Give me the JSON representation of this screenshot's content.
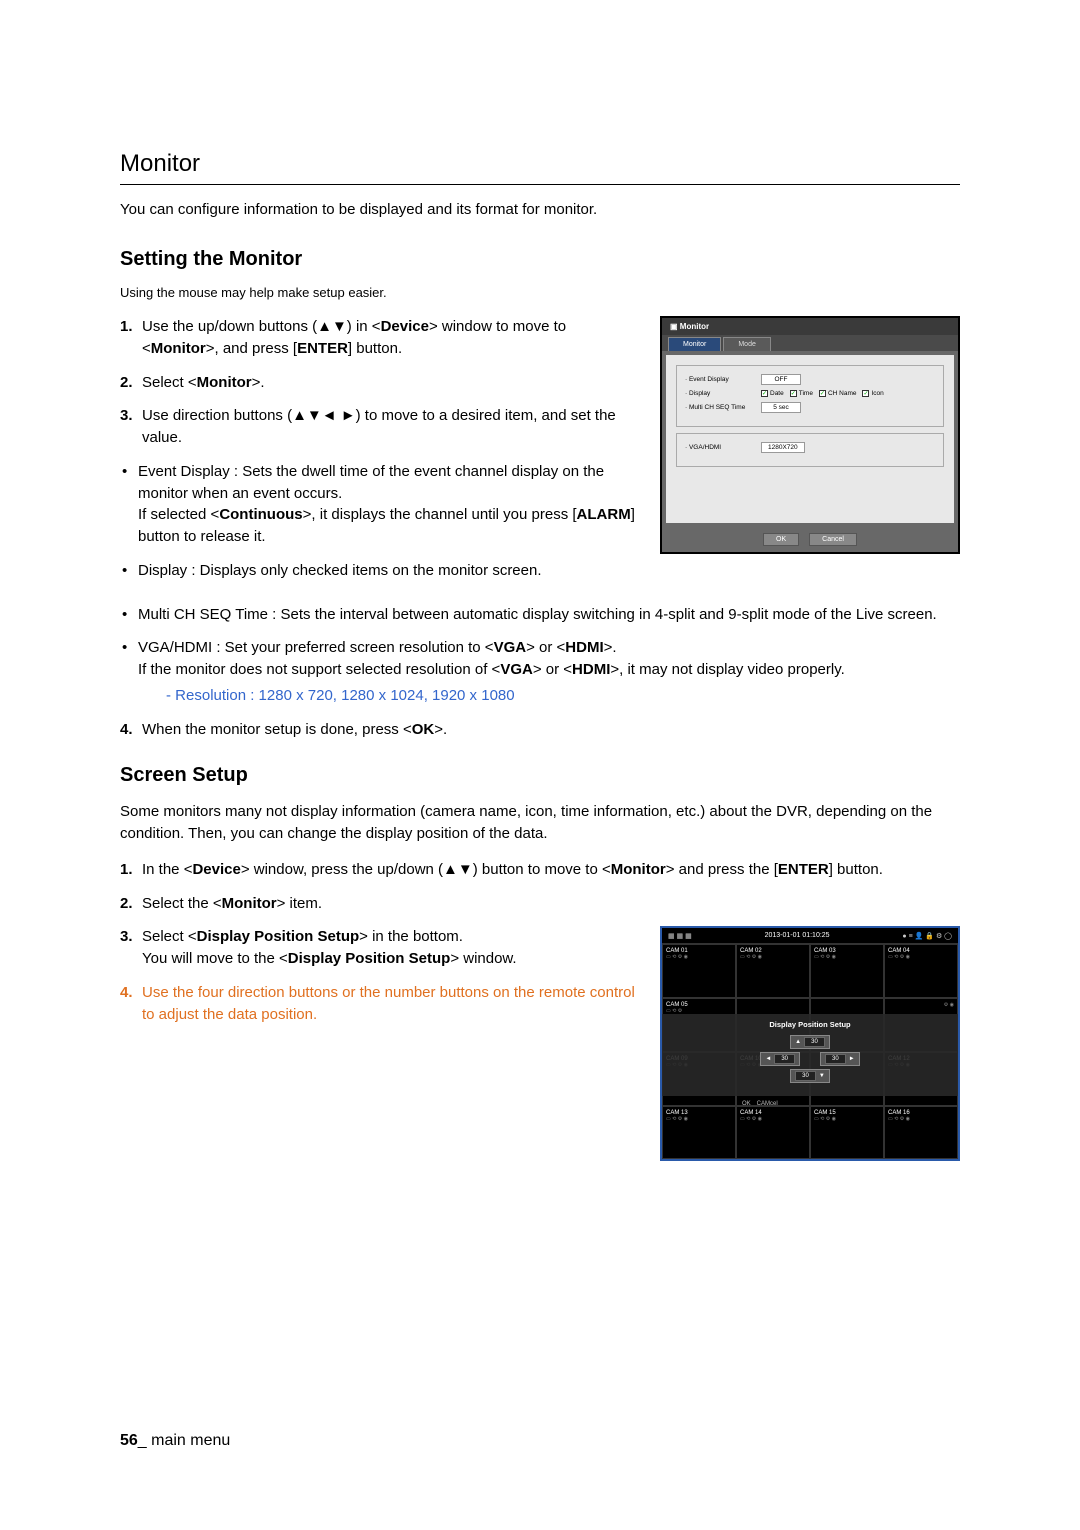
{
  "section_title": "Monitor",
  "intro": "You can configure information to be displayed and its format for monitor.",
  "setting_monitor": {
    "title": "Setting the Monitor",
    "note": "Using the mouse may help make setup easier.",
    "steps": {
      "s1_a": "Use the up/down buttons (▲▼) in <",
      "s1_b": "Device",
      "s1_c": "> window to move to <",
      "s1_d": "Monitor",
      "s1_e": ">, and press [",
      "s1_f": "ENTER",
      "s1_g": "] button.",
      "s2_a": "Select <",
      "s2_b": "Monitor",
      "s2_c": ">.",
      "s3": "Use direction buttons (▲▼◄ ►) to move to a desired item, and set the value.",
      "s4_a": "When the monitor setup is done, press <",
      "s4_b": "OK",
      "s4_c": ">."
    },
    "bullets": {
      "b1_a": "Event Display : Sets the dwell time of the event channel display on the monitor when an event occurs.",
      "b1_b": "If selected <",
      "b1_c": "Continuous",
      "b1_d": ">, it displays the channel until you press [",
      "b1_e": "ALARM",
      "b1_f": "] button to release it.",
      "b2": "Display : Displays only checked items on the monitor screen.",
      "b3": "Multi CH SEQ Time : Sets the interval between automatic display switching in 4-split and 9-split mode of the Live screen.",
      "b4_a": "VGA/HDMI : Set your preferred screen resolution to <",
      "b4_b": "VGA",
      "b4_c": "> or <",
      "b4_d": "HDMI",
      "b4_e": ">.",
      "b4_f": "If the monitor does not support selected resolution of <",
      "b4_g": ">, it may not display video properly."
    },
    "resolution_note": "Resolution : 1280 x 720, 1280 x 1024, 1920 x 1080"
  },
  "fig1": {
    "title": "Monitor",
    "tab1": "Monitor",
    "tab2": "Mode",
    "r1_label": "· Event Display",
    "r1_val": "OFF",
    "r2_label": "· Display",
    "chk_date": "Date",
    "chk_time": "Time",
    "chk_chname": "CH Name",
    "chk_icon": "Icon",
    "r3_label": "· Multi CH SEQ Time",
    "r3_val": "5 sec",
    "r4_label": "· VGA/HDMI",
    "r4_val": "1280X720",
    "ok": "OK",
    "cancel": "Cancel"
  },
  "screen_setup": {
    "title": "Screen Setup",
    "intro": "Some monitors many not display information (camera name, icon, time information, etc.) about the DVR, depending on the condition. Then, you can change the display position of the data.",
    "s1_a": "In the <",
    "s1_b": "Device",
    "s1_c": "> window, press the up/down (▲▼) button to move to <",
    "s1_d": "Monitor",
    "s1_e": "> and press the [",
    "s1_f": "ENTER",
    "s1_g": "] button.",
    "s2_a": "Select the <",
    "s2_b": "Monitor",
    "s2_c": "> item.",
    "s3_a": "Select <",
    "s3_b": "Display Position Setup",
    "s3_c": "> in the bottom.",
    "s3_d": "You will move to the <",
    "s3_e": "> window.",
    "s4": "Use the four direction buttons or the number buttons on the remote control to adjust the data position."
  },
  "fig2": {
    "timestamp": "2013-01-01 01:10:25",
    "overlay_title": "Display Position Setup",
    "val": "30",
    "ok": "OK",
    "cancel": "CAMcel",
    "cams": [
      "CAM 01",
      "CAM 02",
      "CAM 03",
      "CAM 04",
      "CAM 05",
      "",
      "",
      "",
      "CAM 09",
      "CAM 10",
      "",
      "CAM 12",
      "CAM 13",
      "CAM 14",
      "CAM 15",
      "CAM 16"
    ]
  },
  "footer": {
    "page": "56",
    "sep": "_ ",
    "label": "main menu"
  }
}
